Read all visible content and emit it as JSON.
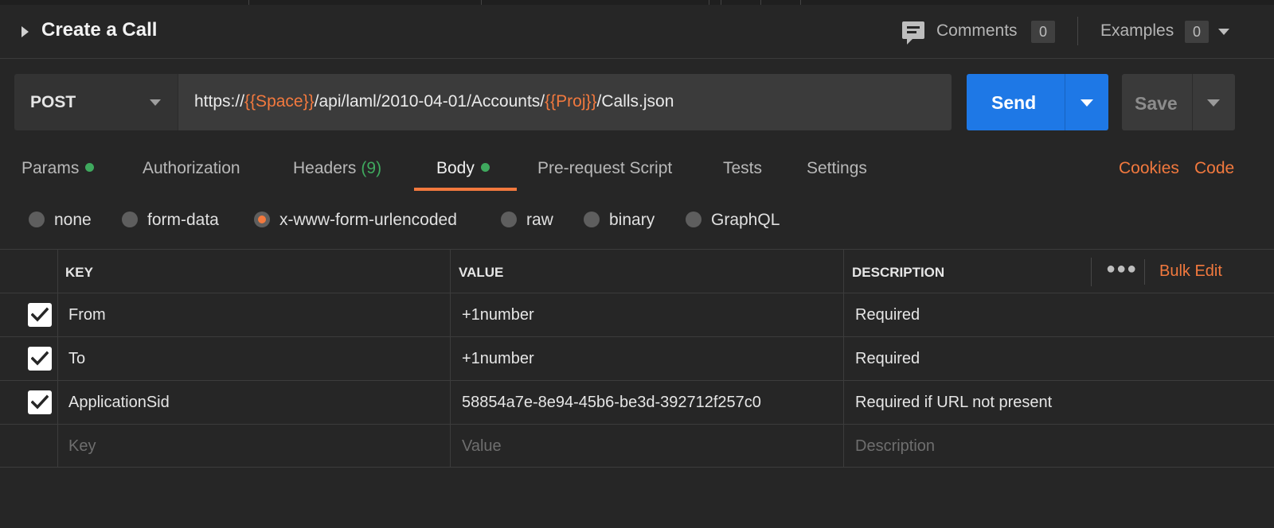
{
  "header": {
    "title": "Create a Call",
    "comments_label": "Comments",
    "comments_count": "0",
    "examples_label": "Examples",
    "examples_count": "0"
  },
  "request": {
    "method": "POST",
    "url_parts": {
      "p1": "https://",
      "v1": "{{Space}}",
      "p2": "/api/laml/2010-04-01/Accounts/",
      "v2": "{{Proj}}",
      "p3": "/Calls.json"
    },
    "send_label": "Send",
    "save_label": "Save"
  },
  "tabs": {
    "params": "Params",
    "authorization": "Authorization",
    "headers": "Headers",
    "headers_count": "(9)",
    "body": "Body",
    "prerequest": "Pre-request Script",
    "tests": "Tests",
    "settings": "Settings",
    "cookies": "Cookies",
    "code": "Code"
  },
  "body_types": {
    "none": "none",
    "form_data": "form-data",
    "urlencoded": "x-www-form-urlencoded",
    "raw": "raw",
    "binary": "binary",
    "graphql": "GraphQL",
    "selected": "x-www-form-urlencoded"
  },
  "table": {
    "headers": {
      "key": "KEY",
      "value": "VALUE",
      "description": "DESCRIPTION"
    },
    "bulk_edit": "Bulk Edit",
    "more_icon": "more-horizontal-icon",
    "rows": [
      {
        "key": "From",
        "value": "+1number",
        "description": "Required"
      },
      {
        "key": "To",
        "value": "+1number",
        "description": "Required"
      },
      {
        "key": "ApplicationSid",
        "value": "58854a7e-8e94-45b6-be3d-392712f257c0",
        "description": "Required if URL not present"
      }
    ],
    "placeholders": {
      "key": "Key",
      "value": "Value",
      "description": "Description"
    }
  },
  "colors": {
    "accent": "#f2793e",
    "send": "#1e78e6",
    "status_green": "#3fa95e",
    "background": "#262626"
  }
}
